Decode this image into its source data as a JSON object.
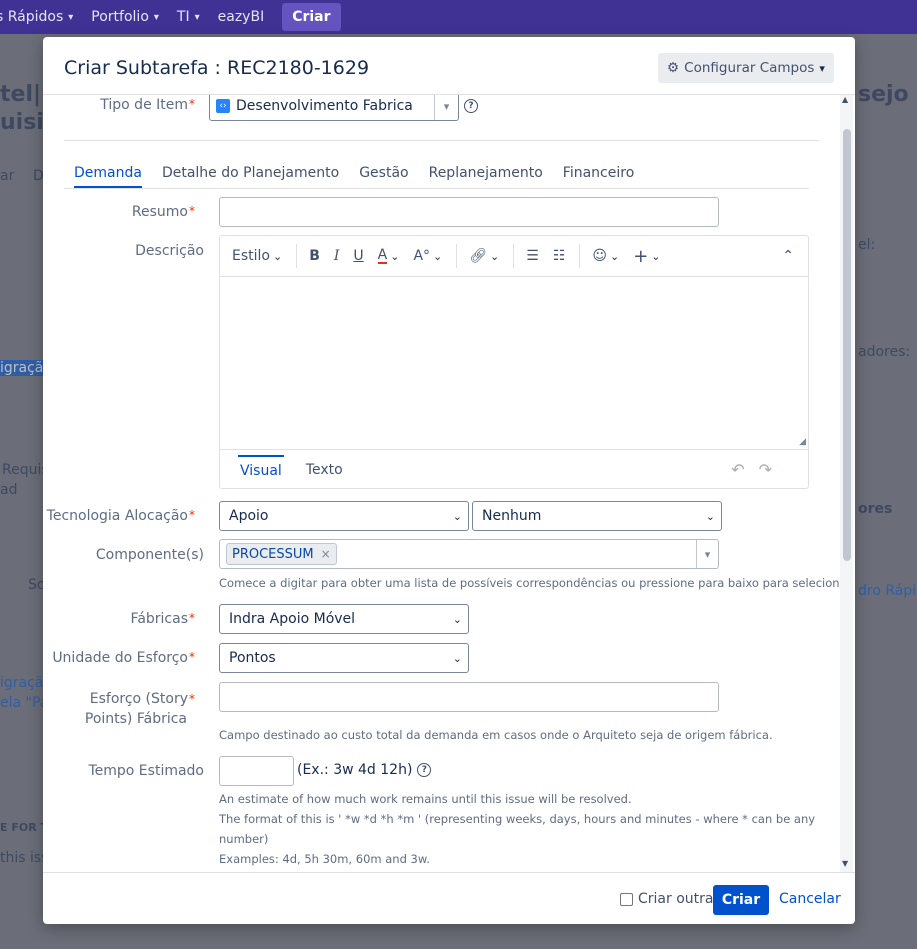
{
  "topnav": {
    "items": [
      {
        "label": "s Rápidos",
        "chevron": true
      },
      {
        "label": "Portfolio",
        "chevron": true
      },
      {
        "label": "TI",
        "chevron": true
      },
      {
        "label": "eazyBI",
        "chevron": false
      }
    ],
    "create_label": "Criar"
  },
  "background": {
    "fragments": [
      "tel|M",
      "uisiçã",
      "ar",
      "D",
      "igração",
      "Requis",
      "ad",
      "So",
      "igração",
      "ela \"Pa",
      "E FOR T",
      "this iss",
      "sejo qu",
      "el:",
      "adores:",
      "ores",
      "dro Rápid"
    ]
  },
  "dialog": {
    "title": "Criar Subtarefa : REC2180-1629",
    "config_button": "Configurar Campos",
    "issue_type": {
      "label": "Tipo de Item",
      "value": "Desenvolvimento Fabrica"
    },
    "tabs": [
      {
        "label": "Demanda",
        "active": true
      },
      {
        "label": "Detalhe do Planejamento",
        "active": false
      },
      {
        "label": "Gestão",
        "active": false
      },
      {
        "label": "Replanejamento",
        "active": false
      },
      {
        "label": "Financeiro",
        "active": false
      }
    ],
    "resumo": {
      "label": "Resumo",
      "value": ""
    },
    "descricao": {
      "label": "Descrição",
      "style_label": "Estilo",
      "tab_visual": "Visual",
      "tab_texto": "Texto"
    },
    "tecnologia": {
      "label": "Tecnologia Alocação",
      "value1": "Apoio",
      "value2": "Nenhum"
    },
    "componentes": {
      "label": "Componente(s)",
      "chip": "PROCESSUM",
      "help": "Comece a digitar para obter uma lista de possíveis correspondências ou pressione para baixo para selecionar."
    },
    "fabricas": {
      "label": "Fábricas",
      "value": "Indra Apoio Móvel"
    },
    "unidade": {
      "label": "Unidade do Esforço",
      "value": "Pontos"
    },
    "esforco": {
      "label_line1": "Esforço (Story",
      "label_line2": "Points) Fábrica",
      "value": "",
      "help": "Campo destinado ao custo total da demanda em casos onde o Arquiteto seja de origem fábrica."
    },
    "tempo": {
      "label": "Tempo Estimado",
      "value": "",
      "hint": "(Ex.: 3w 4d 12h)",
      "help1": "An estimate of how much work remains until this issue will be resolved.",
      "help2": "The format of this is ' *w *d *h *m ' (representing weeks, days, hours and minutes - where * can be any",
      "help3": "number)",
      "help4": "Examples: 4d, 5h 30m, 60m and 3w."
    },
    "footer": {
      "create_another": "Criar outra",
      "create_button": "Criar",
      "cancel": "Cancelar"
    }
  },
  "colors": {
    "nav": "#403294",
    "primary": "#0052cc",
    "required": "#de350b"
  }
}
